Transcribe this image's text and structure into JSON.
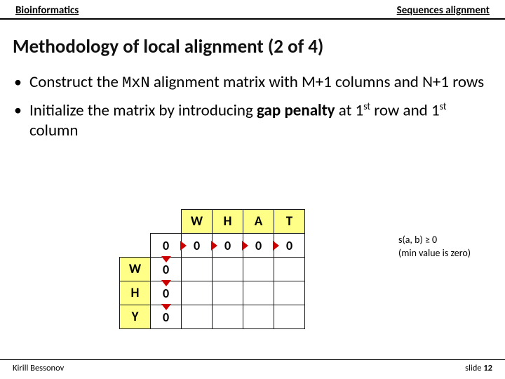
{
  "header": {
    "left": "Bioinformatics",
    "right": "Sequences alignment"
  },
  "title": "Methodology of local alignment (2 of 4)",
  "bullets": {
    "b1_a": "Construct the ",
    "b1_mono": "MxN",
    "b1_b": " alignment matrix with M+1 columns and N+1 rows",
    "b2_a": "Initialize the matrix by introducing ",
    "b2_bold": "gap penalty",
    "b2_b": " at 1",
    "b2_sup1": "st",
    "b2_c": " row and 1",
    "b2_sup2": "st",
    "b2_d": " column"
  },
  "matrix": {
    "col_headers": [
      "W",
      "H",
      "A",
      "T"
    ],
    "row_headers": [
      "W",
      "H",
      "Y"
    ],
    "first_row_vals": [
      "0",
      "0",
      "0",
      "0",
      "0"
    ],
    "first_col_vals": [
      "0",
      "0",
      "0"
    ]
  },
  "legend": {
    "line1": "s(a, b) ≥ 0",
    "line2": "(min value is zero)"
  },
  "footer": {
    "author": "Kirill Bessonov",
    "slide_prefix": "slide ",
    "slide_no": "12"
  }
}
